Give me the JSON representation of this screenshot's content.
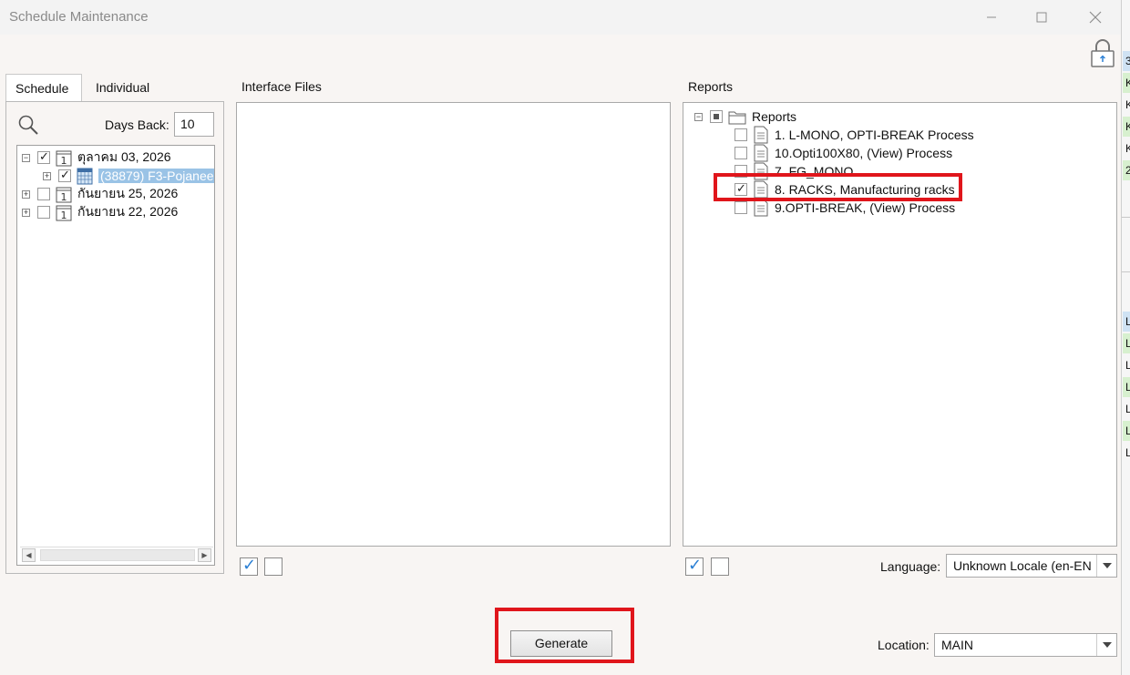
{
  "window": {
    "title": "Schedule Maintenance"
  },
  "tabs": {
    "schedule": "Schedule",
    "individual": "Individual"
  },
  "schedule": {
    "days_back_label": "Days Back:",
    "days_back_value": "10",
    "tree": [
      {
        "label": "ตุลาคม 03, 2026",
        "checked": true,
        "expanded": true
      },
      {
        "label": "(38879) F3-Pojanee",
        "checked": true,
        "selected": true
      },
      {
        "label": "กันยายน 25, 2026",
        "checked": false,
        "expanded": false
      },
      {
        "label": "กันยายน 22, 2026",
        "checked": false,
        "expanded": false
      }
    ]
  },
  "interface_files": {
    "label": "Interface Files"
  },
  "reports": {
    "label": "Reports",
    "root": "Reports",
    "items": [
      {
        "label": "1. L-MONO, OPTI-BREAK Process",
        "checked": false
      },
      {
        "label": "10.Opti100X80, (View) Process",
        "checked": false
      },
      {
        "label": "7. FG_MONO",
        "checked": false
      },
      {
        "label": "8. RACKS, Manufacturing racks",
        "checked": true
      },
      {
        "label": "9.OPTI-BREAK, (View) Process",
        "checked": false
      }
    ]
  },
  "language": {
    "label": "Language:",
    "value": "Unknown Locale (en-EN"
  },
  "location": {
    "label": "Location:",
    "value": "MAIN"
  },
  "generate_label": "Generate",
  "background_strip": [
    "3",
    "K",
    "K",
    "K",
    "K",
    "2",
    "L",
    "L",
    "L",
    "L",
    "L",
    "L",
    "L"
  ],
  "colors": {
    "highlight": "#e0151b",
    "selection": "#9ac3e6",
    "check_blue": "#2a7fd4"
  }
}
